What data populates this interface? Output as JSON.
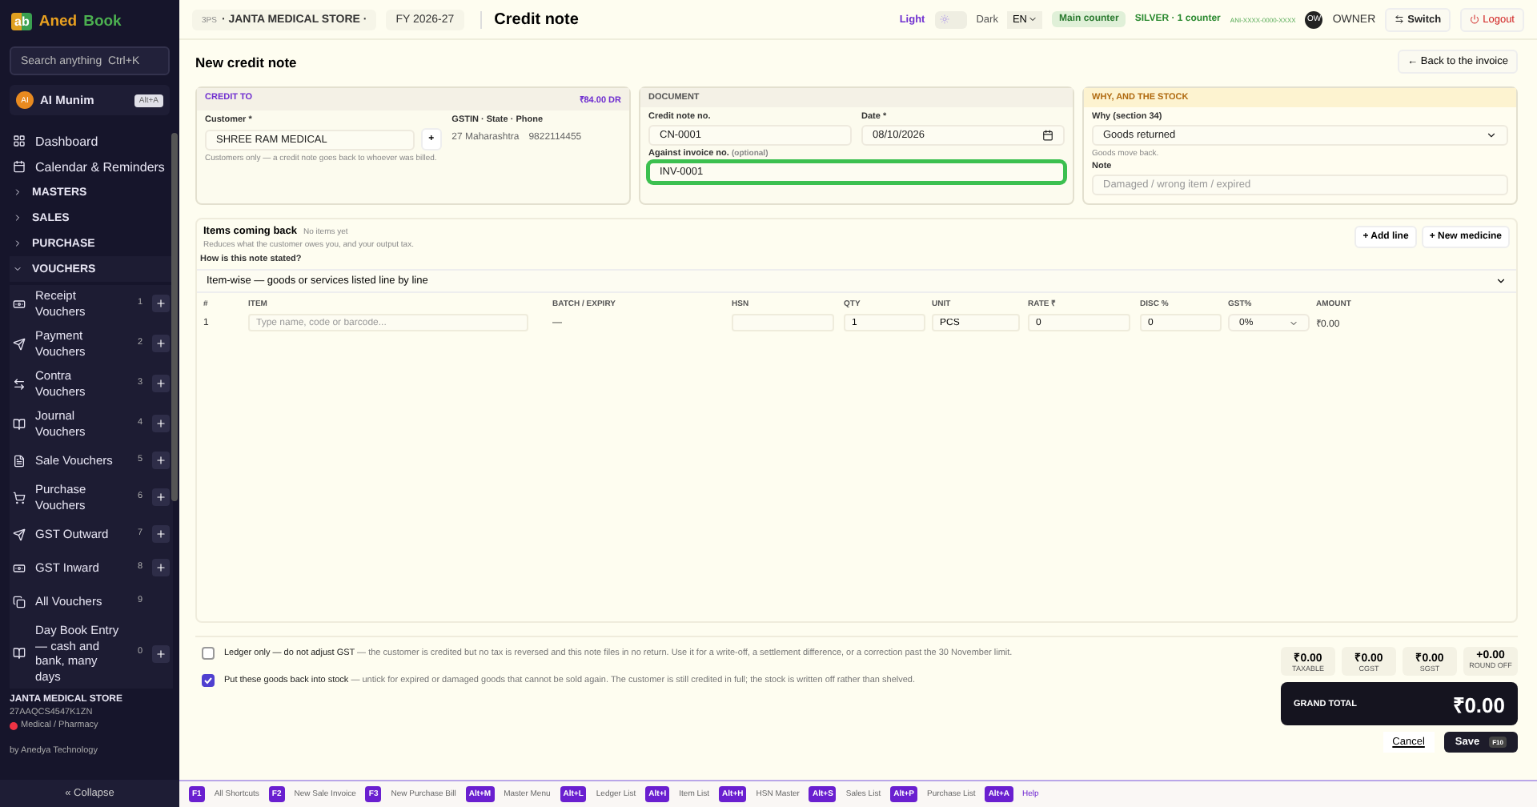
{
  "app": {
    "brand_mark": "ab",
    "brand_first": "Aned",
    "brand_second": "Book",
    "search": {
      "placeholder": "Search anything  Ctrl+K"
    },
    "user": {
      "initials": "AI",
      "name": "AI Munim",
      "shortcut": "Alt+A"
    }
  },
  "sidebar": {
    "items": [
      {
        "kind": "link",
        "label": "Dashboard"
      },
      {
        "kind": "link",
        "label": "Calendar & Reminders"
      },
      {
        "kind": "group",
        "label": "MASTERS",
        "expanded": false
      },
      {
        "kind": "group",
        "label": "SALES",
        "expanded": false
      },
      {
        "kind": "group",
        "label": "PURCHASE",
        "expanded": false
      },
      {
        "kind": "group",
        "label": "VOUCHERS",
        "expanded": true,
        "children": [
          {
            "label": "Receipt Vouchers",
            "key": "1",
            "add": true
          },
          {
            "label": "Payment Vouchers",
            "key": "2",
            "add": true
          },
          {
            "label": "Contra Vouchers",
            "key": "3",
            "add": true
          },
          {
            "label": "Journal Vouchers",
            "key": "4",
            "add": true
          },
          {
            "label": "Sale Vouchers",
            "key": "5",
            "add": true
          },
          {
            "label": "Purchase Vouchers",
            "key": "6",
            "add": true
          },
          {
            "label": "GST Outward",
            "key": "7",
            "add": true
          },
          {
            "label": "GST Inward",
            "key": "8",
            "add": true
          },
          {
            "label": "All Vouchers",
            "key": "9",
            "add": false
          },
          {
            "label": "Day Book Entry — cash and bank, many days",
            "key": "0",
            "add": true
          }
        ]
      }
    ],
    "company": {
      "name": "JANTA MEDICAL STORE",
      "gstin": "27AAQCS4547K1ZN",
      "type": "Medical / Pharmacy"
    },
    "credit": "by Anedya Technology",
    "collapse": "« Collapse"
  },
  "topbar": {
    "company_code": "3PS",
    "company": "· JANTA MEDICAL STORE ·",
    "fy": "FY 2026-27",
    "title": "Credit note",
    "theme": [
      {
        "label": "Light",
        "selected": true
      },
      {
        "label": "Dark",
        "selected": false
      }
    ],
    "language": "EN",
    "counter": "Main counter",
    "plan": "SILVER · 1 counter",
    "licence": "ANI-XXXX-0000-XXXX",
    "role_initials": "OW",
    "role": "OWNER",
    "switch": "Switch",
    "logout": "Logout"
  },
  "form": {
    "heading": "New credit note",
    "back": "← Back to the invoice",
    "credit_to": {
      "title": "CREDIT TO",
      "balance": "₹84.00 DR",
      "customer_label": "Customer *",
      "customer": "SHREE RAM MEDICAL",
      "add": "+",
      "customer_hint": "Customers only — a credit note goes back to whoever was billed.",
      "info_label": "GSTIN · State · Phone",
      "state": "27 Maharashtra",
      "phone": "9822114455"
    },
    "document": {
      "title": "DOCUMENT",
      "number_label": "Credit note no.",
      "number": "CN-0001",
      "date_label": "Date *",
      "date": "08/10/2026",
      "invoice_label": "Against invoice no.",
      "invoice_optional": "(optional)",
      "invoice": "INV-0001",
      "invoice_focused": true
    },
    "reason": {
      "title": "WHY, AND THE STOCK",
      "why_label": "Why (section 34)",
      "why": "Goods returned",
      "why_hint": "Goods move back.",
      "note_label": "Note",
      "note_placeholder": "Damaged / wrong item / expired"
    }
  },
  "items": {
    "title": "Items coming back",
    "count": "No items yet",
    "subtitle": "Reduces what the customer owes you, and your output tax.",
    "add_line": "+ Add line",
    "new_medicine": "+ New medicine",
    "mode_label": "How is this note stated?",
    "mode": "Item-wise — goods or services listed line by line",
    "columns": [
      "#",
      "ITEM",
      "BATCH / EXPIRY",
      "HSN",
      "QTY",
      "UNIT",
      "RATE ₹",
      "DISC %",
      "GST%",
      "AMOUNT"
    ],
    "rows": [
      {
        "no": "1",
        "item_placeholder": "Type name, code or barcode...",
        "batch": "—",
        "hsn": "",
        "qty": "1",
        "unit": "PCS",
        "rate": "0",
        "disc": "0",
        "gst": "0%",
        "amount": "₹0.00"
      }
    ]
  },
  "options": [
    {
      "text": "**Ledger only — do not adjust GST** — the customer is credited but no tax is reversed and this note files in no return. Use it for a write-off, a settlement difference, or a correction past the 30 November limit.",
      "checked": false
    },
    {
      "text": "**Put these goods back into stock** — untick for expired or damaged goods that cannot be sold again. The customer is still credited in full; the stock is written off rather than shelved.",
      "checked": true
    }
  ],
  "totals": [
    {
      "value": "₹0.00",
      "label": "TAXABLE"
    },
    {
      "value": "₹0.00",
      "label": "CGST"
    },
    {
      "value": "₹0.00",
      "label": "SGST"
    },
    {
      "value": "+0.00",
      "label": "ROUND OFF"
    }
  ],
  "grand_total": {
    "label": "GRAND TOTAL",
    "value": "₹0.00"
  },
  "actions": {
    "cancel": "Cancel",
    "save": "Save",
    "save_key": "F10"
  },
  "shortcuts": [
    {
      "key": "F1",
      "label": "All Shortcuts"
    },
    {
      "key": "F2",
      "label": "New Sale Invoice"
    },
    {
      "key": "F3",
      "label": "New Purchase Bill"
    },
    {
      "key": "Alt+M",
      "label": "Master Menu"
    },
    {
      "key": "Alt+L",
      "label": "Ledger List"
    },
    {
      "key": "Alt+I",
      "label": "Item List"
    },
    {
      "key": "Alt+H",
      "label": "HSN Master"
    },
    {
      "key": "Alt+S",
      "label": "Sales List"
    },
    {
      "key": "Alt+P",
      "label": "Purchase List"
    },
    {
      "key": "Alt+A",
      "label": "Help"
    }
  ]
}
